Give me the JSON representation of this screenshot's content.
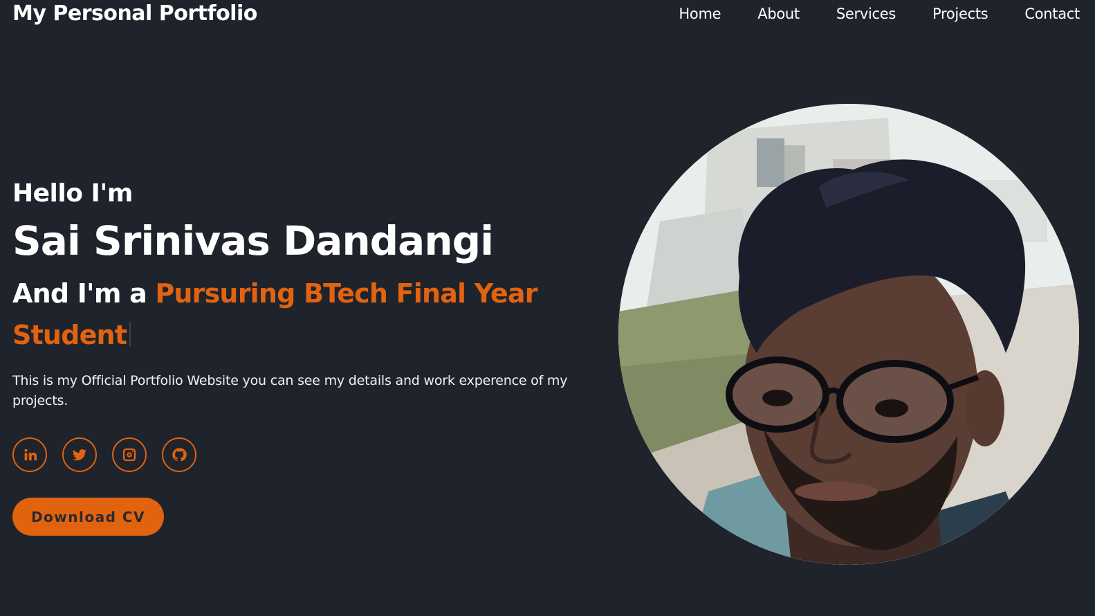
{
  "navbar": {
    "logo": "My Personal Portfolio",
    "links": [
      "Home",
      "About",
      "Services",
      "Projects",
      "Contact"
    ]
  },
  "hero": {
    "greeting": "Hello I'm",
    "name": "Sai Srinivas Dandangi",
    "role_prefix": "And I'm a ",
    "role_highlight": "Pursuring BTech Final Year Student",
    "bio": "This is my Official Portfolio Website you can see my details and work experence of my projects.",
    "social_icons": [
      "linkedin-icon",
      "twitter-icon",
      "instagram-icon",
      "github-icon"
    ],
    "cv_button": "Download CV"
  },
  "colors": {
    "background": "#1f232c",
    "accent": "#e2630f",
    "text": "#ffffff"
  }
}
